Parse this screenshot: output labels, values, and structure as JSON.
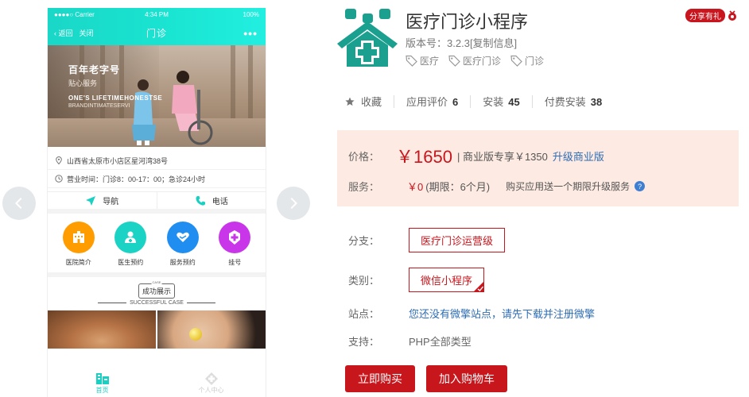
{
  "phone": {
    "status": {
      "carrier": "●●●●○ Carrier",
      "time": "4:34 PM",
      "battery": "100%"
    },
    "nav": {
      "back": "返回",
      "close": "关闭",
      "title": "门诊",
      "more": "•••"
    },
    "banner": {
      "title": "百年老字号",
      "subtitle": "贴心服务",
      "en_line1": "ONE'S LIFETIMEHONESTSE",
      "en_line2": "BRANDINTIMATESERVI"
    },
    "address": "山西省太原市小店区星河湾38号",
    "hours": "营业时间：门诊8：00-17：00；急诊24小时",
    "actions": [
      {
        "label": "导航",
        "icon": "navigation-arrow-icon"
      },
      {
        "label": "电话",
        "icon": "phone-icon"
      }
    ],
    "services": [
      {
        "label": "医院简介",
        "icon": "hospital-building-icon",
        "color": "#ff9c00"
      },
      {
        "label": "医生预约",
        "icon": "doctor-icon",
        "color": "#1ad3c4"
      },
      {
        "label": "服务预约",
        "icon": "handshake-heart-icon",
        "color": "#1f8ef0"
      },
      {
        "label": "挂号",
        "icon": "medical-cross-icon",
        "color": "#c935e8"
      }
    ],
    "case": {
      "title": "成功展示",
      "subtitle": "SUCCESSFUL CASE"
    },
    "tabs": [
      {
        "label": "首页",
        "active": true
      },
      {
        "label": "个人中心",
        "active": false
      }
    ]
  },
  "product": {
    "title": "医疗门诊小程序",
    "share_label": "分享有礼",
    "version_label": "版本号：",
    "version": "3.2.3",
    "copy_info": "[复制信息]",
    "tags": [
      "医疗",
      "医疗门诊",
      "门诊"
    ],
    "stats": {
      "favorite": "收藏",
      "rating_label": "应用评价",
      "rating": "6",
      "install_label": "安装",
      "installs": "45",
      "paid_label": "付费安装",
      "paid": "38"
    },
    "price": {
      "label": "价格：",
      "value": "￥1650",
      "business": "| 商业版专享￥1350",
      "upgrade": "升级商业版"
    },
    "service": {
      "label": "服务：",
      "value": "￥0",
      "period": "(期限：6个月)",
      "note": "购买应用送一个期限升级服务",
      "help": "?"
    },
    "branch": {
      "label": "分支：",
      "value": "医疗门诊运营级"
    },
    "category": {
      "label": "类别：",
      "value": "微信小程序"
    },
    "site": {
      "label": "站点：",
      "value": "您还没有微擎站点，请先下载并注册微擎"
    },
    "support": {
      "label": "支持：",
      "value": "PHP全部类型"
    },
    "buttons": {
      "buy": "立即购买",
      "cart": "加入购物车"
    }
  },
  "colors": {
    "accent_red": "#c8161d",
    "teal": "#1ad7c7",
    "link_blue": "#2e6db5",
    "price_bg": "#fdeae2"
  }
}
